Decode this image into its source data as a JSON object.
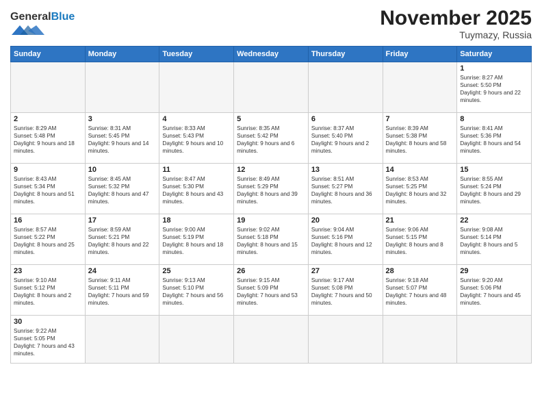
{
  "header": {
    "logo_general": "General",
    "logo_blue": "Blue",
    "month_title": "November 2025",
    "location": "Tuymazy, Russia"
  },
  "weekdays": [
    "Sunday",
    "Monday",
    "Tuesday",
    "Wednesday",
    "Thursday",
    "Friday",
    "Saturday"
  ],
  "weeks": [
    [
      {
        "day": "",
        "empty": true
      },
      {
        "day": "",
        "empty": true
      },
      {
        "day": "",
        "empty": true
      },
      {
        "day": "",
        "empty": true
      },
      {
        "day": "",
        "empty": true
      },
      {
        "day": "",
        "empty": true
      },
      {
        "day": "1",
        "sunrise": "Sunrise: 8:27 AM",
        "sunset": "Sunset: 5:50 PM",
        "daylight": "Daylight: 9 hours and 22 minutes."
      }
    ],
    [
      {
        "day": "2",
        "sunrise": "Sunrise: 8:29 AM",
        "sunset": "Sunset: 5:48 PM",
        "daylight": "Daylight: 9 hours and 18 minutes."
      },
      {
        "day": "3",
        "sunrise": "Sunrise: 8:31 AM",
        "sunset": "Sunset: 5:45 PM",
        "daylight": "Daylight: 9 hours and 14 minutes."
      },
      {
        "day": "4",
        "sunrise": "Sunrise: 8:33 AM",
        "sunset": "Sunset: 5:43 PM",
        "daylight": "Daylight: 9 hours and 10 minutes."
      },
      {
        "day": "5",
        "sunrise": "Sunrise: 8:35 AM",
        "sunset": "Sunset: 5:42 PM",
        "daylight": "Daylight: 9 hours and 6 minutes."
      },
      {
        "day": "6",
        "sunrise": "Sunrise: 8:37 AM",
        "sunset": "Sunset: 5:40 PM",
        "daylight": "Daylight: 9 hours and 2 minutes."
      },
      {
        "day": "7",
        "sunrise": "Sunrise: 8:39 AM",
        "sunset": "Sunset: 5:38 PM",
        "daylight": "Daylight: 8 hours and 58 minutes."
      },
      {
        "day": "8",
        "sunrise": "Sunrise: 8:41 AM",
        "sunset": "Sunset: 5:36 PM",
        "daylight": "Daylight: 8 hours and 54 minutes."
      }
    ],
    [
      {
        "day": "9",
        "sunrise": "Sunrise: 8:43 AM",
        "sunset": "Sunset: 5:34 PM",
        "daylight": "Daylight: 8 hours and 51 minutes."
      },
      {
        "day": "10",
        "sunrise": "Sunrise: 8:45 AM",
        "sunset": "Sunset: 5:32 PM",
        "daylight": "Daylight: 8 hours and 47 minutes."
      },
      {
        "day": "11",
        "sunrise": "Sunrise: 8:47 AM",
        "sunset": "Sunset: 5:30 PM",
        "daylight": "Daylight: 8 hours and 43 minutes."
      },
      {
        "day": "12",
        "sunrise": "Sunrise: 8:49 AM",
        "sunset": "Sunset: 5:29 PM",
        "daylight": "Daylight: 8 hours and 39 minutes."
      },
      {
        "day": "13",
        "sunrise": "Sunrise: 8:51 AM",
        "sunset": "Sunset: 5:27 PM",
        "daylight": "Daylight: 8 hours and 36 minutes."
      },
      {
        "day": "14",
        "sunrise": "Sunrise: 8:53 AM",
        "sunset": "Sunset: 5:25 PM",
        "daylight": "Daylight: 8 hours and 32 minutes."
      },
      {
        "day": "15",
        "sunrise": "Sunrise: 8:55 AM",
        "sunset": "Sunset: 5:24 PM",
        "daylight": "Daylight: 8 hours and 29 minutes."
      }
    ],
    [
      {
        "day": "16",
        "sunrise": "Sunrise: 8:57 AM",
        "sunset": "Sunset: 5:22 PM",
        "daylight": "Daylight: 8 hours and 25 minutes."
      },
      {
        "day": "17",
        "sunrise": "Sunrise: 8:59 AM",
        "sunset": "Sunset: 5:21 PM",
        "daylight": "Daylight: 8 hours and 22 minutes."
      },
      {
        "day": "18",
        "sunrise": "Sunrise: 9:00 AM",
        "sunset": "Sunset: 5:19 PM",
        "daylight": "Daylight: 8 hours and 18 minutes."
      },
      {
        "day": "19",
        "sunrise": "Sunrise: 9:02 AM",
        "sunset": "Sunset: 5:18 PM",
        "daylight": "Daylight: 8 hours and 15 minutes."
      },
      {
        "day": "20",
        "sunrise": "Sunrise: 9:04 AM",
        "sunset": "Sunset: 5:16 PM",
        "daylight": "Daylight: 8 hours and 12 minutes."
      },
      {
        "day": "21",
        "sunrise": "Sunrise: 9:06 AM",
        "sunset": "Sunset: 5:15 PM",
        "daylight": "Daylight: 8 hours and 8 minutes."
      },
      {
        "day": "22",
        "sunrise": "Sunrise: 9:08 AM",
        "sunset": "Sunset: 5:14 PM",
        "daylight": "Daylight: 8 hours and 5 minutes."
      }
    ],
    [
      {
        "day": "23",
        "sunrise": "Sunrise: 9:10 AM",
        "sunset": "Sunset: 5:12 PM",
        "daylight": "Daylight: 8 hours and 2 minutes."
      },
      {
        "day": "24",
        "sunrise": "Sunrise: 9:11 AM",
        "sunset": "Sunset: 5:11 PM",
        "daylight": "Daylight: 7 hours and 59 minutes."
      },
      {
        "day": "25",
        "sunrise": "Sunrise: 9:13 AM",
        "sunset": "Sunset: 5:10 PM",
        "daylight": "Daylight: 7 hours and 56 minutes."
      },
      {
        "day": "26",
        "sunrise": "Sunrise: 9:15 AM",
        "sunset": "Sunset: 5:09 PM",
        "daylight": "Daylight: 7 hours and 53 minutes."
      },
      {
        "day": "27",
        "sunrise": "Sunrise: 9:17 AM",
        "sunset": "Sunset: 5:08 PM",
        "daylight": "Daylight: 7 hours and 50 minutes."
      },
      {
        "day": "28",
        "sunrise": "Sunrise: 9:18 AM",
        "sunset": "Sunset: 5:07 PM",
        "daylight": "Daylight: 7 hours and 48 minutes."
      },
      {
        "day": "29",
        "sunrise": "Sunrise: 9:20 AM",
        "sunset": "Sunset: 5:06 PM",
        "daylight": "Daylight: 7 hours and 45 minutes."
      }
    ],
    [
      {
        "day": "30",
        "sunrise": "Sunrise: 9:22 AM",
        "sunset": "Sunset: 5:05 PM",
        "daylight": "Daylight: 7 hours and 43 minutes."
      },
      {
        "day": "",
        "empty": true
      },
      {
        "day": "",
        "empty": true
      },
      {
        "day": "",
        "empty": true
      },
      {
        "day": "",
        "empty": true
      },
      {
        "day": "",
        "empty": true
      },
      {
        "day": "",
        "empty": true
      }
    ]
  ]
}
